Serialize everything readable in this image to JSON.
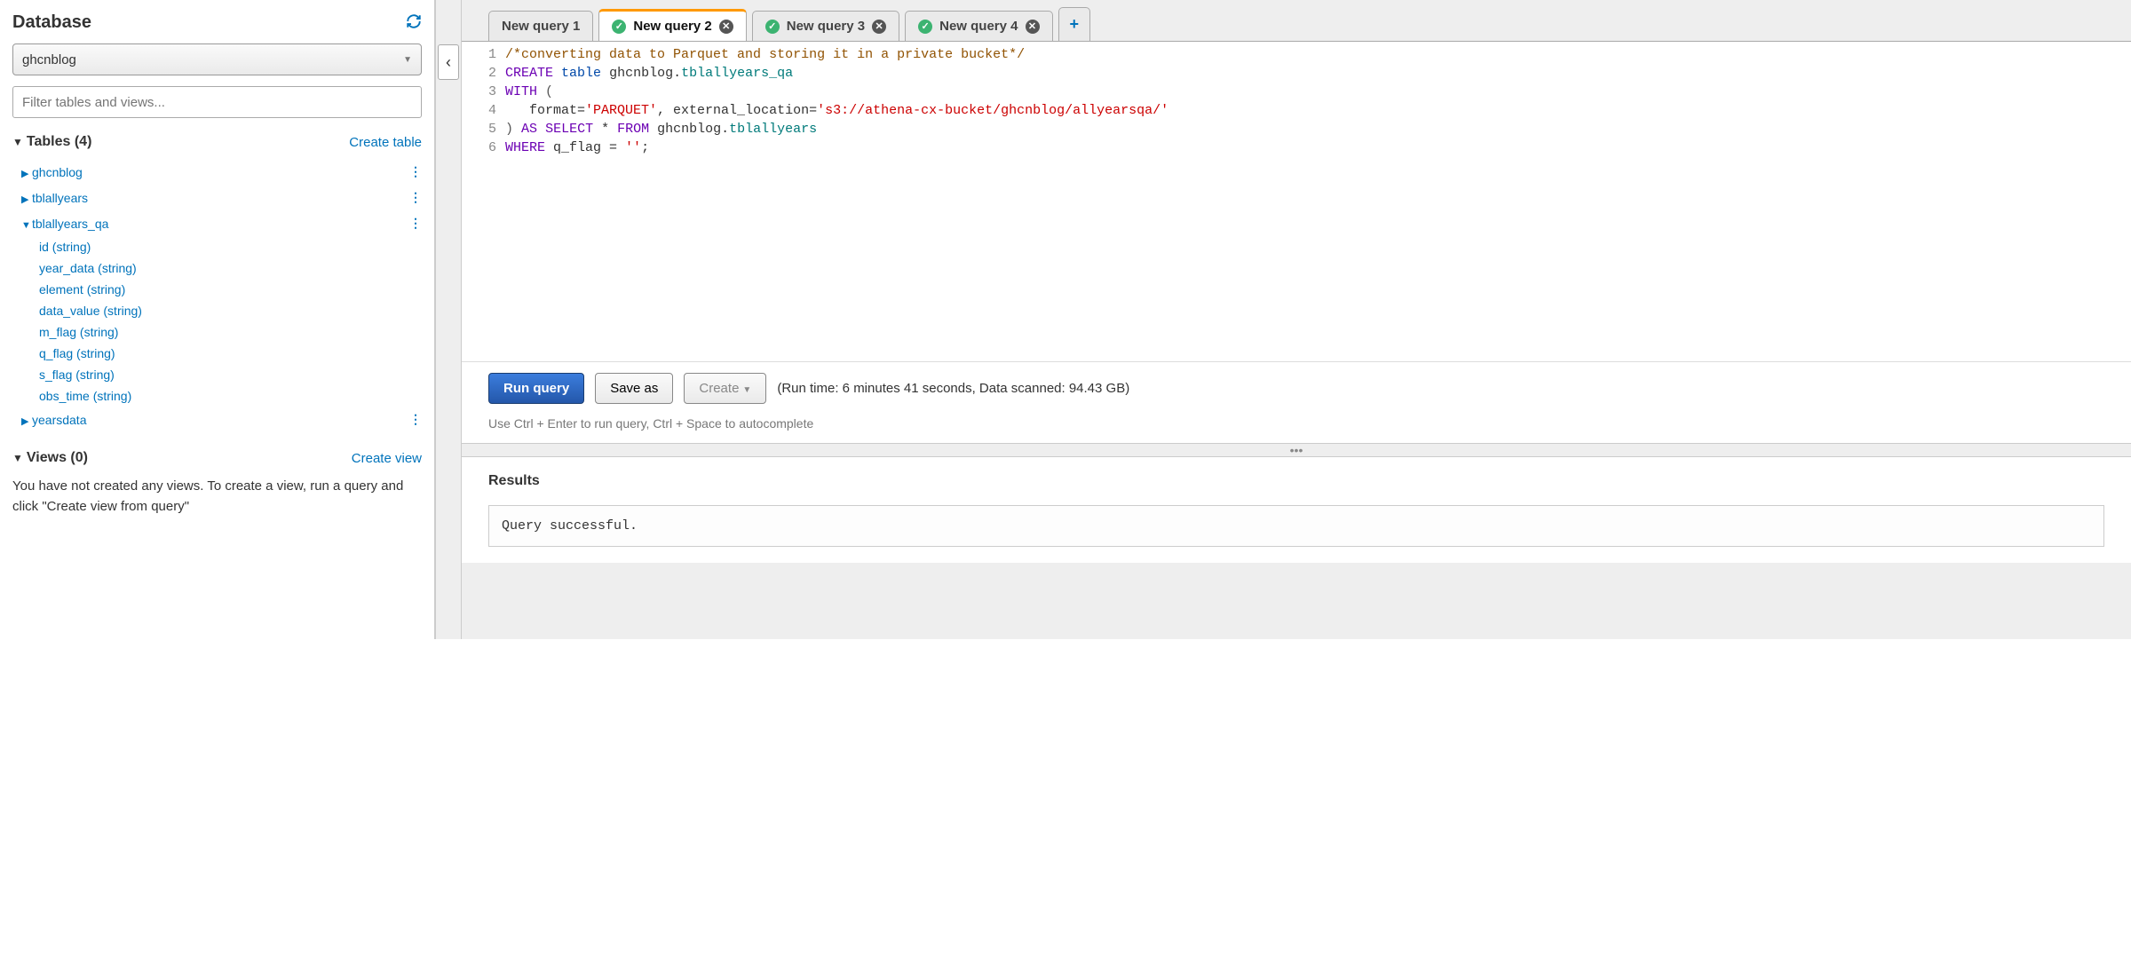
{
  "sidebar": {
    "title": "Database",
    "selected_db": "ghcnblog",
    "filter_placeholder": "Filter tables and views...",
    "tables_header": "Tables (4)",
    "create_table": "Create table",
    "tables": [
      {
        "name": "ghcnblog",
        "expanded": false
      },
      {
        "name": "tblallyears",
        "expanded": false
      },
      {
        "name": "tblallyears_qa",
        "expanded": true,
        "columns": [
          "id (string)",
          "year_data (string)",
          "element (string)",
          "data_value (string)",
          "m_flag (string)",
          "q_flag (string)",
          "s_flag (string)",
          "obs_time (string)"
        ]
      },
      {
        "name": "yearsdata",
        "expanded": false
      }
    ],
    "views_header": "Views (0)",
    "create_view": "Create view",
    "views_note": "You have not created any views. To create a view, run a query and click \"Create view from query\""
  },
  "tabs": [
    {
      "label": "New query 1",
      "status": "none",
      "closable": false
    },
    {
      "label": "New query 2",
      "status": "ok",
      "closable": true,
      "active": true
    },
    {
      "label": "New query 3",
      "status": "ok",
      "closable": true
    },
    {
      "label": "New query 4",
      "status": "ok",
      "closable": true
    }
  ],
  "editor": {
    "lines": [
      {
        "n": "1",
        "html": "<span class='c-comment'>/*converting data to Parquet and storing it in a private bucket*/</span>"
      },
      {
        "n": "2",
        "html": "<span class='c-kw'>CREATE</span> <span class='c-kw2'>table</span> ghcnblog.<span class='c-id'>tblallyears_qa</span>"
      },
      {
        "n": "3",
        "html": "<span class='c-kw'>WITH</span> <span class='c-op'>(</span>"
      },
      {
        "n": "4",
        "html": "   format=<span class='c-str'>'PARQUET'</span>, external_location=<span class='c-str'>'s3://athena-cx-bucket/ghcnblog/allyearsqa/'</span>"
      },
      {
        "n": "5",
        "html": "<span class='c-op'>)</span> <span class='c-kw'>AS</span> <span class='c-kw'>SELECT</span> * <span class='c-kw'>FROM</span> ghcnblog.<span class='c-id'>tblallyears</span>"
      },
      {
        "n": "6",
        "html": "<span class='c-kw'>WHERE</span> q_flag = <span class='c-str'>''</span>;"
      }
    ]
  },
  "toolbar": {
    "run": "Run query",
    "save": "Save as",
    "create": "Create",
    "meta": "(Run time: 6 minutes 41 seconds, Data scanned: 94.43 GB)",
    "hint": "Use Ctrl + Enter to run query, Ctrl + Space to autocomplete"
  },
  "results": {
    "title": "Results",
    "message": "Query successful."
  }
}
